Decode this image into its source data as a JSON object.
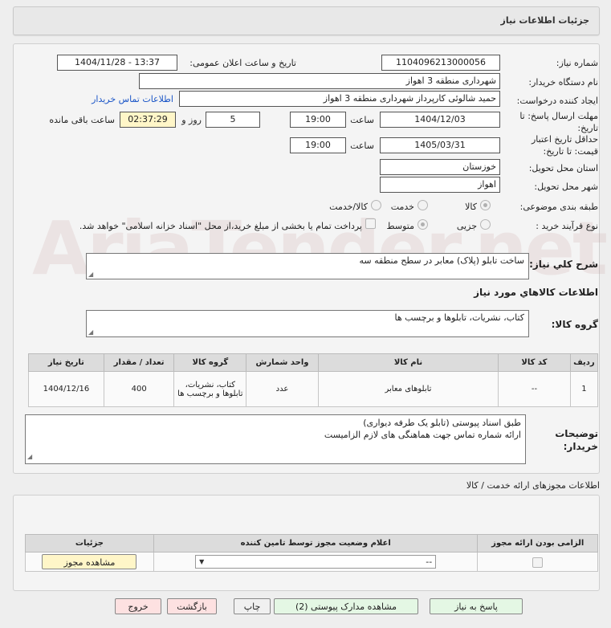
{
  "header": {
    "title": "جزئیات اطلاعات نیاز"
  },
  "form": {
    "need_number_label": "شماره نیاز:",
    "need_number": "1104096213000056",
    "announce_label": "تاریخ و ساعت اعلان عمومی:",
    "announce_value": "1404/11/28 - 13:37",
    "buyer_org_label": "نام دستگاه خریدار:",
    "buyer_org": "شهرداری منطقه 3 اهواز",
    "requester_label": "ایجاد کننده درخواست:",
    "requester": "حمید شالوئی کارپرداز شهرداری منطقه 3 اهواز",
    "contact_link": "اطلاعات تماس خریدار",
    "reply_deadline_label": "مهلت ارسال پاسخ: تا تاریخ:",
    "reply_date": "1404/12/03",
    "time_label": "ساعت",
    "reply_time": "19:00",
    "days_value": "5",
    "days_label": "روز و",
    "remaining_time": "02:37:29",
    "remaining_label": "ساعت باقی مانده",
    "validity_label": "حداقل تاریخ اعتبار قیمت: تا تاریخ:",
    "validity_date": "1405/03/31",
    "validity_time": "19:00",
    "province_label": "استان محل تحویل:",
    "province": "خوزستان",
    "city_label": "شهر محل تحویل:",
    "city": "اهواز",
    "category_label": "طبقه بندی موضوعی:",
    "category_options": [
      "کالا",
      "خدمت",
      "کالا/خدمت"
    ],
    "process_label": "نوع فرآیند خرید :",
    "process_options": [
      "جزیی",
      "متوسط"
    ],
    "payment_note": "پرداخت تمام یا بخشی از مبلغ خرید،از محل \"اسناد خزانه اسلامی\" خواهد شد."
  },
  "summary": {
    "label": "شرح کلي نياز:",
    "text": "ساخت تابلو (پلاک) معابر در سطح منطقه سه"
  },
  "goods": {
    "section_title": "اطلاعات کالاهاي مورد نياز",
    "group_label": "گروه کالا:",
    "group_value": "کتاب، نشریات، تابلوها و برچسب ها",
    "columns": [
      "ردیف",
      "کد کالا",
      "نام کالا",
      "واحد شمارش",
      "گروه کالا",
      "تعداد / مقدار",
      "تاریخ نیاز"
    ],
    "rows": [
      {
        "idx": "1",
        "code": "--",
        "name": "تابلوهای معابر",
        "unit": "عدد",
        "group": "کتاب، نشریات، تابلوها و برچسب ها",
        "qty": "400",
        "date": "1404/12/16"
      }
    ]
  },
  "buyer_notes": {
    "label": "توضیحات خریدار:",
    "line1": "طبق اسناد پیوستی (تابلو یک طرفه دیواری)",
    "line2": "ارائه شماره تماس جهت هماهنگی های لازم الزامیست"
  },
  "permits": {
    "section_title": "اطلاعات مجوزهای ارائه خدمت / کالا",
    "columns": [
      "الزامی بودن ارائه مجوز",
      "اعلام وضعیت مجوز توسط تامین کننده",
      "جزئیات"
    ],
    "select_value": "--",
    "view_button": "مشاهده مجوز"
  },
  "buttons": {
    "reply": "پاسخ به نیاز",
    "attachments": "مشاهده مدارک پیوستی (2)",
    "print": "چاپ",
    "back": "بازگشت",
    "exit": "خروج"
  },
  "watermark": "AriaTender.net"
}
